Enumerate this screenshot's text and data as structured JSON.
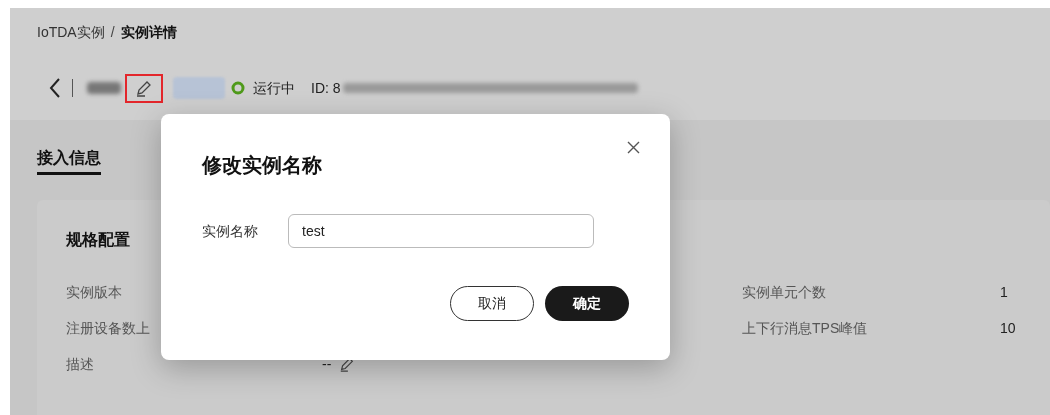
{
  "breadcrumb": [
    {
      "label": "IoTDA实例",
      "current": false
    },
    {
      "label": "实例详情",
      "current": true
    }
  ],
  "breadcrumb_separator": "/",
  "header": {
    "status": "运行中",
    "id_prefix": "ID: 8"
  },
  "tabs": [
    {
      "label": "接入信息",
      "selected": true
    }
  ],
  "card": {
    "title": "规格配置",
    "left_rows": [
      {
        "label": "实例版本",
        "value": ""
      },
      {
        "label": "注册设备数上",
        "value": ""
      },
      {
        "label": "描述",
        "value": "--",
        "editable": true
      }
    ],
    "right_rows": [
      {
        "label": "实例单元个数",
        "value": "1"
      },
      {
        "label": "上下行消息TPS峰值",
        "value": "10"
      }
    ]
  },
  "dialog": {
    "title": "修改实例名称",
    "field_label": "实例名称",
    "field_value": "test",
    "buttons": [
      {
        "label": "取消",
        "kind": "secondary"
      },
      {
        "label": "确定",
        "kind": "primary"
      }
    ]
  }
}
